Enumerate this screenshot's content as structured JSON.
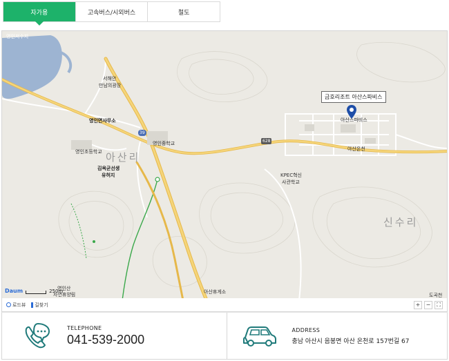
{
  "tabs": [
    {
      "label": "자가용",
      "active": true
    },
    {
      "label": "고속버스/시외버스",
      "active": false
    },
    {
      "label": "철도",
      "active": false
    }
  ],
  "map": {
    "labels": {
      "reservoir": "영인저수지",
      "seohaean": "서해안",
      "seohaean2": "만남의광장",
      "yeongin_office": "영인면사무소",
      "yeongin_middle": "영인중학교",
      "yeongin_elem": "영인초등학교",
      "kim_okgyun1": "김옥균선생",
      "kim_okgyun2": "유허지",
      "asan_region": "아산리",
      "kpec1": "KPEC혁신",
      "kpec2": "사관학교",
      "asan_spa_station": "아산온천",
      "spa_village": "아산스파비스",
      "sinsu_ri": "신수리",
      "asan_rest": "아산휴게소",
      "yeongin_san1": "영인산",
      "yeongin_san2": "자연휴양림",
      "village_edge": "도곡천"
    },
    "callout": "금호리조트 아산스파비스",
    "road_39": "39",
    "road_628": "628",
    "logo": "Daum",
    "scale_text": "250m"
  },
  "toolbar": {
    "roadview": "로드뷰",
    "directions": "길찾기",
    "zoom_in": "+",
    "zoom_out": "−",
    "fullscreen": "⛶"
  },
  "contact": {
    "telephone_label": "TELEPHONE",
    "telephone_value": "041-539-2000",
    "address_label": "ADDRESS",
    "address_value": "충남 아산시 음봉면 아산 온천로 157번길 67"
  },
  "colors": {
    "accent": "#1db26a",
    "road_major": "#f0c85a",
    "icon_teal": "#1f7a7a"
  }
}
